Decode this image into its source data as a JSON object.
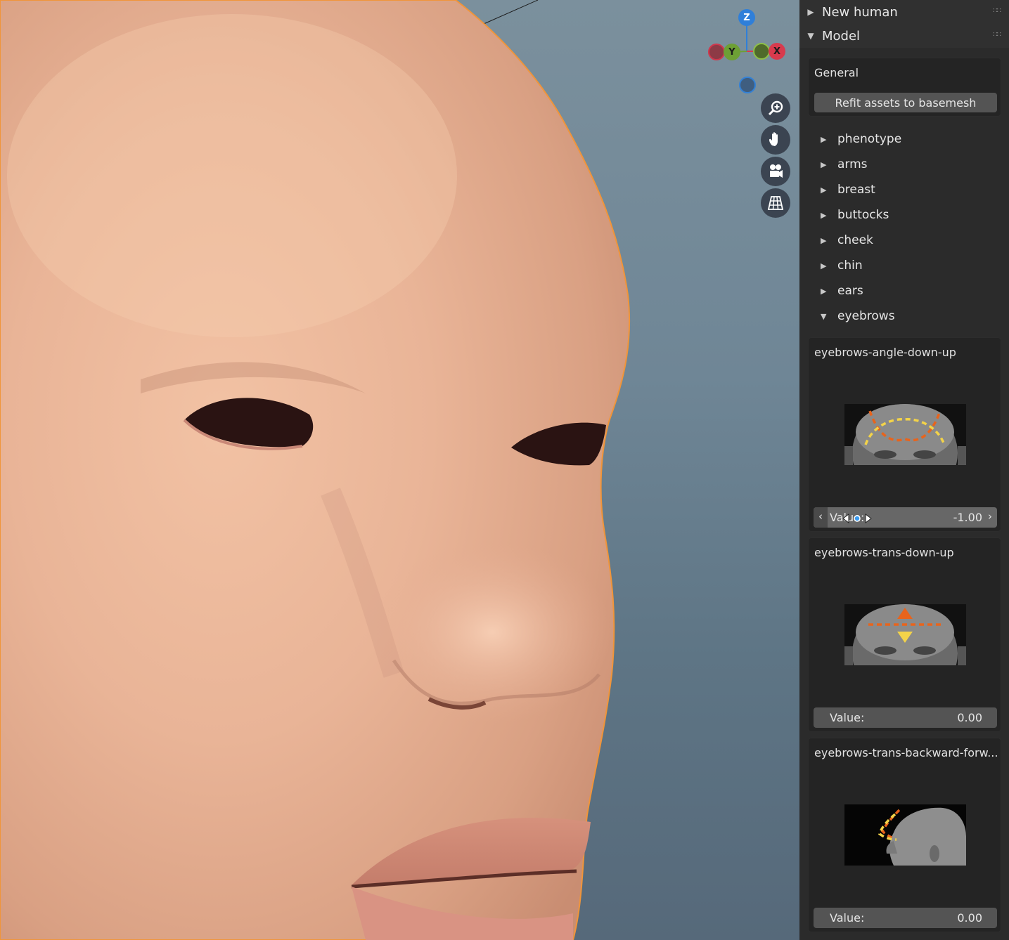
{
  "viewport": {
    "gizmo": {
      "z_label": "Z",
      "y_label": "Y",
      "x_label": "X"
    },
    "nav_buttons": [
      "zoom-icon",
      "hand-pan-icon",
      "camera-icon",
      "grid-perspective-icon"
    ]
  },
  "sidebar": {
    "panels": [
      {
        "label": "New human",
        "expanded": false
      },
      {
        "label": "Model",
        "expanded": true
      }
    ],
    "general": {
      "title": "General",
      "refit_button": "Refit assets to basemesh"
    },
    "categories": [
      "phenotype",
      "arms",
      "breast",
      "buttocks",
      "cheek",
      "chin",
      "ears",
      "eyebrows"
    ],
    "expanded_category": "eyebrows",
    "modifiers": [
      {
        "title": "eyebrows-angle-down-up",
        "value_label": "Value:",
        "value": "-1.00",
        "active": true
      },
      {
        "title": "eyebrows-trans-down-up",
        "value_label": "Value:",
        "value": "0.00",
        "active": false
      },
      {
        "title": "eyebrows-trans-backward-forw...",
        "value_label": "Value:",
        "value": "0.00",
        "active": false
      }
    ]
  },
  "colors": {
    "sidebar_bg": "#303030",
    "box_bg": "#242424",
    "field_bg": "#545454",
    "selection_outline": "#f0953a",
    "axis_x": "#d83a4d",
    "axis_y": "#6da035",
    "axis_z": "#2f7fd9"
  }
}
